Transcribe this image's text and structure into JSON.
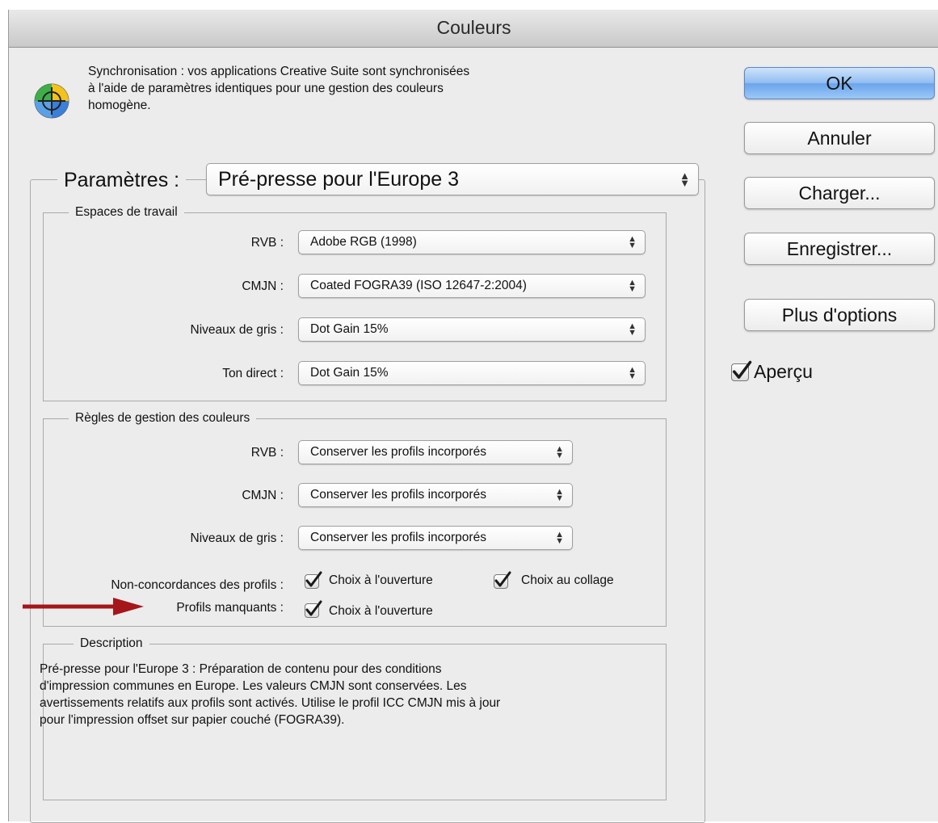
{
  "window": {
    "title": "Couleurs"
  },
  "info": {
    "icon": "color-wheel-icon",
    "line1": "Synchronisation : vos applications Creative Suite sont synchronisées",
    "line2": "à l'aide de paramètres identiques pour une gestion des couleurs",
    "line3": "homogène."
  },
  "settings": {
    "label": "Paramètres :",
    "value": "Pré-presse pour l'Europe 3"
  },
  "working_spaces": {
    "legend": "Espaces de travail",
    "rows": [
      {
        "label": "RVB :",
        "value": "Adobe RGB (1998)"
      },
      {
        "label": "CMJN :",
        "value": "Coated FOGRA39 (ISO 12647-2:2004)"
      },
      {
        "label": "Niveaux de gris :",
        "value": "Dot Gain 15%"
      },
      {
        "label": "Ton direct :",
        "value": "Dot Gain 15%"
      }
    ]
  },
  "policies": {
    "legend": "Règles de gestion des couleurs",
    "rows": [
      {
        "label": "RVB :",
        "value": "Conserver les profils incorporés"
      },
      {
        "label": "CMJN :",
        "value": "Conserver les profils incorporés"
      },
      {
        "label": "Niveaux de gris :",
        "value": "Conserver les profils incorporés"
      }
    ],
    "mismatch_label": "Non-concordances des profils :",
    "mismatch_open": {
      "label": "Choix à l'ouverture",
      "checked": true
    },
    "mismatch_paste": {
      "label": "Choix au collage",
      "checked": true
    },
    "missing_label": "Profils manquants :",
    "missing_open": {
      "label": "Choix à l'ouverture",
      "checked": true
    }
  },
  "description": {
    "legend": "Description",
    "line1": "Pré-presse pour l'Europe 3 :  Préparation de contenu pour des conditions",
    "line2": "d'impression communes en Europe. Les valeurs CMJN sont conservées. Les",
    "line3": "avertissements relatifs aux profils sont activés. Utilise le profil ICC CMJN mis à jour",
    "line4": "pour l'impression offset sur papier couché (FOGRA39)."
  },
  "buttons": {
    "ok": "OK",
    "cancel": "Annuler",
    "load": "Charger...",
    "save": "Enregistrer...",
    "more": "Plus d'options"
  },
  "preview": {
    "label": "Aperçu",
    "checked": true
  },
  "colors": {
    "accent": "#6aa4ec",
    "arrow": "#a5161a"
  }
}
